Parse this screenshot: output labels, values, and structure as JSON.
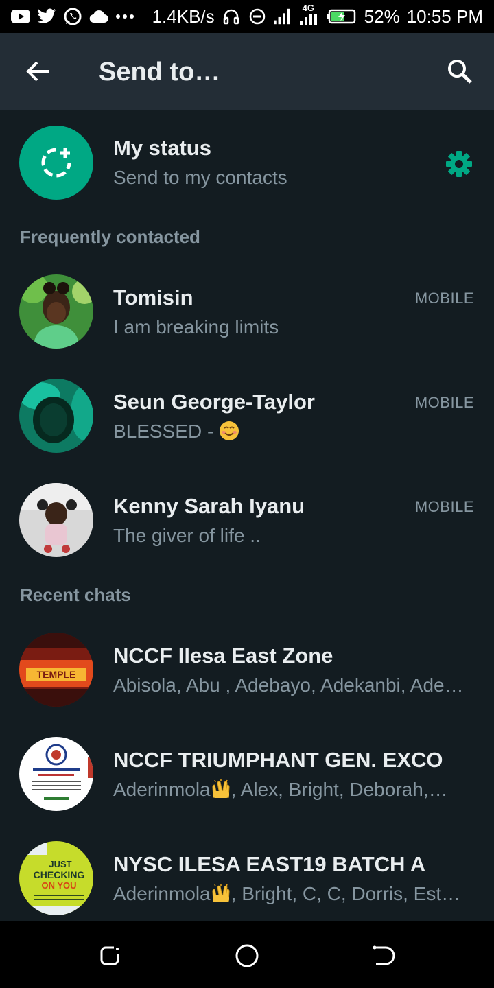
{
  "status_bar": {
    "net_speed": "1.4KB/s",
    "network": "4G",
    "battery": "52%",
    "time": "10:55 PM",
    "icons": [
      "youtube-icon",
      "twitter-icon",
      "whatsapp-icon",
      "cloud-icon",
      "more-notifications-icon",
      "headset-icon",
      "dnd-icon",
      "signal-icon",
      "battery-icon"
    ]
  },
  "header": {
    "title": "Send to…",
    "back_icon": "arrow-left-icon",
    "search_icon": "search-icon"
  },
  "my_status": {
    "title": "My status",
    "subtitle": "Send to my contacts",
    "icon": "add-status-icon",
    "settings_icon": "gear-icon",
    "accent": "#00a884"
  },
  "sections": {
    "frequent": "Frequently contacted",
    "recent": "Recent chats"
  },
  "frequent_contacts": [
    {
      "name": "Tomisin",
      "status": "I am breaking limits",
      "tag": "MOBILE"
    },
    {
      "name": "Seun George-Taylor",
      "status": "BLESSED - ",
      "tag": "MOBILE"
    },
    {
      "name": "Kenny Sarah Iyanu",
      "status": "The giver of life ..",
      "tag": "MOBILE"
    }
  ],
  "recent_chats": [
    {
      "name": "NCCF Ilesa East Zone",
      "members": "Abisola, Abu , Adebayo, Adekanbi, Ade…"
    },
    {
      "name": "NCCF TRIUMPHANT GEN. EXCO",
      "members_pre": "Aderinmola",
      "members_post": ", Alex, Bright, Deborah,…"
    },
    {
      "name": "NYSC ILESA EAST19 BATCH A",
      "members_pre": "Aderinmola",
      "members_post": ", Bright, C, C, Dorris, Est…"
    }
  ],
  "avatar_text": {
    "temple": "TEMPLE",
    "checking_1": "JUST",
    "checking_2": "CHECKING",
    "checking_3": "ON YOU"
  },
  "colors": {
    "background": "#131c21",
    "appbar": "#232d36",
    "primary_text": "#e9edef",
    "secondary_text": "#8696a0",
    "accent": "#00a884"
  }
}
